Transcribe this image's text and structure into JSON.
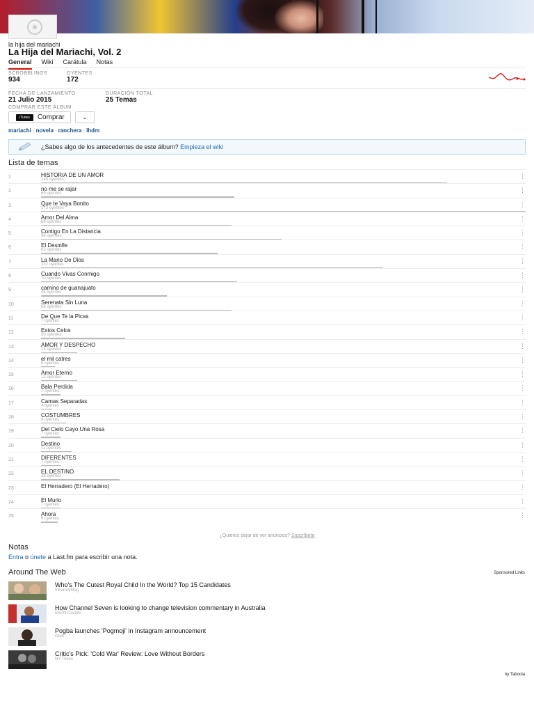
{
  "header": {
    "artist": "la hija del mariachi",
    "album_title": "La Hija del Mariachi, Vol. 2"
  },
  "nav": [
    "General",
    "Wiki",
    "Carátula",
    "Notas"
  ],
  "stats": {
    "scrobblings_label": "SCROBBLINGS",
    "scrobblings": "934",
    "listeners_label": "OYENTES",
    "listeners": "172",
    "release_label": "FECHA DE LANZAMIENTO",
    "release": "21 Julio 2015",
    "duration_label": "DURACIÓN TOTAL",
    "duration": "25 Temas",
    "buy_label": "COMPRAR ESTE ÁLBUM"
  },
  "buy": {
    "store": "iTunes",
    "button": "Comprar",
    "dropdown": "⌄"
  },
  "tags": [
    "mariachi",
    "novela",
    "ranchera",
    "lhdm"
  ],
  "wiki": {
    "text": "¿Sabes algo de los antecedentes de este álbum?",
    "link": "Empieza el wiki"
  },
  "tracklist_heading": "Lista de temas",
  "tracks": [
    {
      "n": "1",
      "title": "HISTORIA DE UN AMOR",
      "listeners": "145 oyentes",
      "count": 145
    },
    {
      "n": "2",
      "title": "no me se rajar",
      "listeners": "69 oyentes",
      "count": 69
    },
    {
      "n": "3",
      "title": "Que te Vaya Bonito",
      "listeners": "173 oyentes",
      "count": 173
    },
    {
      "n": "4",
      "title": "Amor Del Alma",
      "listeners": "68 oyentes",
      "count": 68
    },
    {
      "n": "5",
      "title": "Contigo En La Distancia",
      "listeners": "86 oyentes",
      "count": 86
    },
    {
      "n": "6",
      "title": "El Desinfle",
      "listeners": "63 oyentes",
      "count": 63
    },
    {
      "n": "7",
      "title": "La Mano De Dios",
      "listeners": "122 oyentes",
      "count": 122
    },
    {
      "n": "8",
      "title": "Cuando Vivas Conmigo",
      "listeners": "70 oyentes",
      "count": 70
    },
    {
      "n": "9",
      "title": "camino de guanajuato",
      "listeners": "45 oyentes",
      "count": 45
    },
    {
      "n": "10",
      "title": "Serenata Sin Luna",
      "listeners": "68 oyentes",
      "count": 68
    },
    {
      "n": "11",
      "title": "De Que Te la Picas",
      "listeners": "7 oyentes",
      "count": 7
    },
    {
      "n": "12",
      "title": "Estos Celos",
      "listeners": "30 oyentes",
      "count": 30
    },
    {
      "n": "13",
      "title": "AMOR Y DESPECHO",
      "listeners": "13 oyentes",
      "count": 13
    },
    {
      "n": "14",
      "title": "el mil catres",
      "listeners": "5 oyentes",
      "count": 5
    },
    {
      "n": "15",
      "title": "Amor Eterno",
      "listeners": "13 oyentes",
      "count": 13
    },
    {
      "n": "16",
      "title": "Bala Perdida",
      "listeners": "7 oyentes",
      "count": 7
    },
    {
      "n": "17",
      "title": "Camas Separadas",
      "listeners": "4 oyentes",
      "count": 4
    },
    {
      "n": "18",
      "title": "COSTUMBRES",
      "listeners": "9 oyentes",
      "count": 9
    },
    {
      "n": "19",
      "title": "Del Cielo Cayo Una Rosa",
      "listeners": "7 oyentes",
      "count": 7
    },
    {
      "n": "20",
      "title": "Destino",
      "listeners": "11 oyentes",
      "count": 11
    },
    {
      "n": "21",
      "title": "DIFERENTES",
      "listeners": "7 oyentes",
      "count": 7
    },
    {
      "n": "22",
      "title": "EL DESTINO",
      "listeners": "28 oyentes",
      "count": 28
    },
    {
      "n": "23",
      "title": "El Herradero (El Herradero)",
      "listeners": "",
      "count": 0
    },
    {
      "n": "24",
      "title": "El Murio",
      "listeners": "7 oyentes",
      "count": 7
    },
    {
      "n": "25",
      "title": "Ahora",
      "listeners": "6 oyentes",
      "count": 6
    }
  ],
  "ads_notice": {
    "text": "¿Quieres dejar de ver anuncios?",
    "link": "Suscríbete"
  },
  "notes": {
    "heading": "Notas",
    "login": "Entra",
    "or": " o ",
    "join": "únete",
    "rest": " a Last.fm para escribir una nota."
  },
  "around": {
    "heading": "Around The Web",
    "sponsored": "Sponsored Links",
    "items": [
      {
        "title": "Who's The Cutest Royal Child In the World? Top 15 Candidates",
        "source": "InFamilyMag",
        "thumb": "royal-child-thumb"
      },
      {
        "title": "How Channel Seven is looking to change television commentary in Australia",
        "source": "ESPN Cricinfo",
        "thumb": "cricket-thumb"
      },
      {
        "title": "Pogba launches 'Pogmoji' in Instagram announcement",
        "source": "Goal",
        "thumb": "pogba-thumb"
      },
      {
        "title": "Critic's Pick: 'Cold War' Review: Love Without Borders",
        "source": "NY Times",
        "thumb": "cold-war-thumb"
      }
    ],
    "by": "by Taboola"
  },
  "colors": {
    "accent": "#d51007",
    "link": "#1a6bb0",
    "tag": "#1a4f8a"
  }
}
